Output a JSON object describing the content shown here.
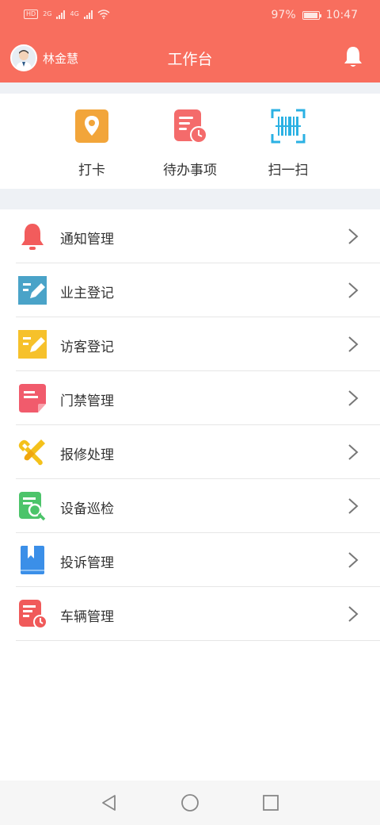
{
  "status_bar": {
    "network_left": "HD",
    "signal1": "2G",
    "signal2": "4G",
    "battery": "97%",
    "time": "10:47"
  },
  "header": {
    "username": "林金慧",
    "title": "工作台",
    "bell_icon": "bell-icon"
  },
  "quick_actions": [
    {
      "label": "打卡",
      "icon": "location-pin-icon",
      "color": "#F2A53A"
    },
    {
      "label": "待办事项",
      "icon": "todo-clock-icon",
      "color": "#F46B6B"
    },
    {
      "label": "扫一扫",
      "icon": "barcode-scan-icon",
      "color": "#2BB1E3"
    }
  ],
  "menu": [
    {
      "label": "通知管理",
      "icon": "bell-icon",
      "color": "#F25C5C"
    },
    {
      "label": "业主登记",
      "icon": "edit-note-icon",
      "color": "#4AA3C8"
    },
    {
      "label": "访客登记",
      "icon": "edit-note-icon",
      "color": "#F6C12B"
    },
    {
      "label": "门禁管理",
      "icon": "document-icon",
      "color": "#F15B6C"
    },
    {
      "label": "报修处理",
      "icon": "wrench-screwdriver-icon",
      "color": "#F4C11B"
    },
    {
      "label": "设备巡检",
      "icon": "document-search-icon",
      "color": "#4CC46A"
    },
    {
      "label": "投诉管理",
      "icon": "bookmark-book-icon",
      "color": "#3B8FE8"
    },
    {
      "label": "车辆管理",
      "icon": "document-clock-icon",
      "color": "#F05A5A"
    }
  ],
  "colors": {
    "header_bg": "#F86E5E",
    "section_gap": "#EEF1F5"
  }
}
